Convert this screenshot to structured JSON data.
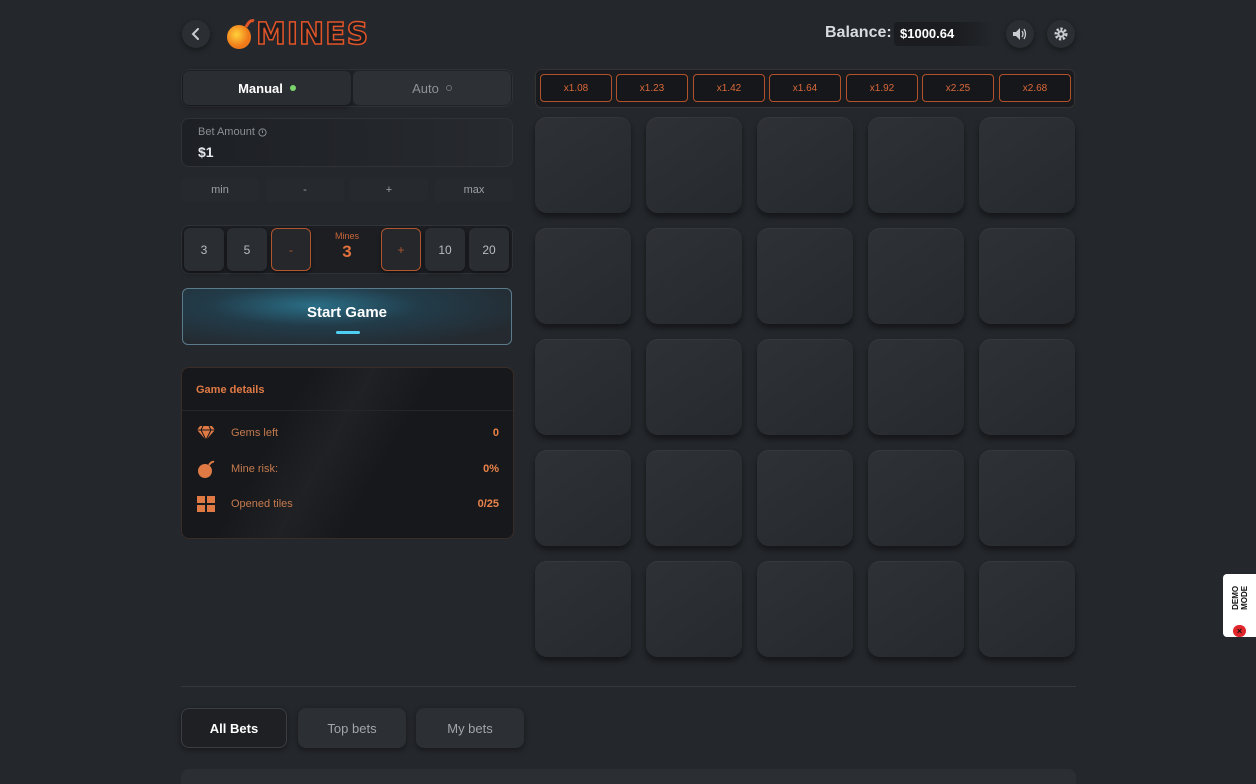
{
  "header": {
    "logo_text": "MINES",
    "balance_label": "Balance:",
    "balance_value": "$1000.64"
  },
  "mode_tabs": {
    "manual_label": "Manual",
    "auto_label": "Auto"
  },
  "bet": {
    "label": "Bet Amount",
    "value": "$1",
    "min_label": "min",
    "minus_label": "-",
    "plus_label": "+",
    "max_label": "max"
  },
  "mines": {
    "presets": [
      "3",
      "5",
      "10",
      "20"
    ],
    "minus_label": "-",
    "plus_label": "+",
    "label": "Mines",
    "value": "3"
  },
  "start_game_label": "Start Game",
  "game_details": {
    "title": "Game details",
    "rows": [
      {
        "icon": "diamond-icon",
        "label": "Gems left",
        "value": "0"
      },
      {
        "icon": "bomb-icon",
        "label": "Mine risk:",
        "value": "0%"
      },
      {
        "icon": "grid-icon",
        "label": "Opened tiles",
        "value": "0/25"
      }
    ]
  },
  "multipliers": [
    "x1.08",
    "x1.23",
    "x1.42",
    "x1.64",
    "x1.92",
    "x2.25",
    "x2.68"
  ],
  "bets_tabs": {
    "all": "All Bets",
    "top": "Top bets",
    "mine": "My bets"
  },
  "demo_badge": "DEMO MODE",
  "colors": {
    "accent_orange": "#e0703d",
    "start_blue": "#4fd0f2",
    "background": "#24272b"
  }
}
